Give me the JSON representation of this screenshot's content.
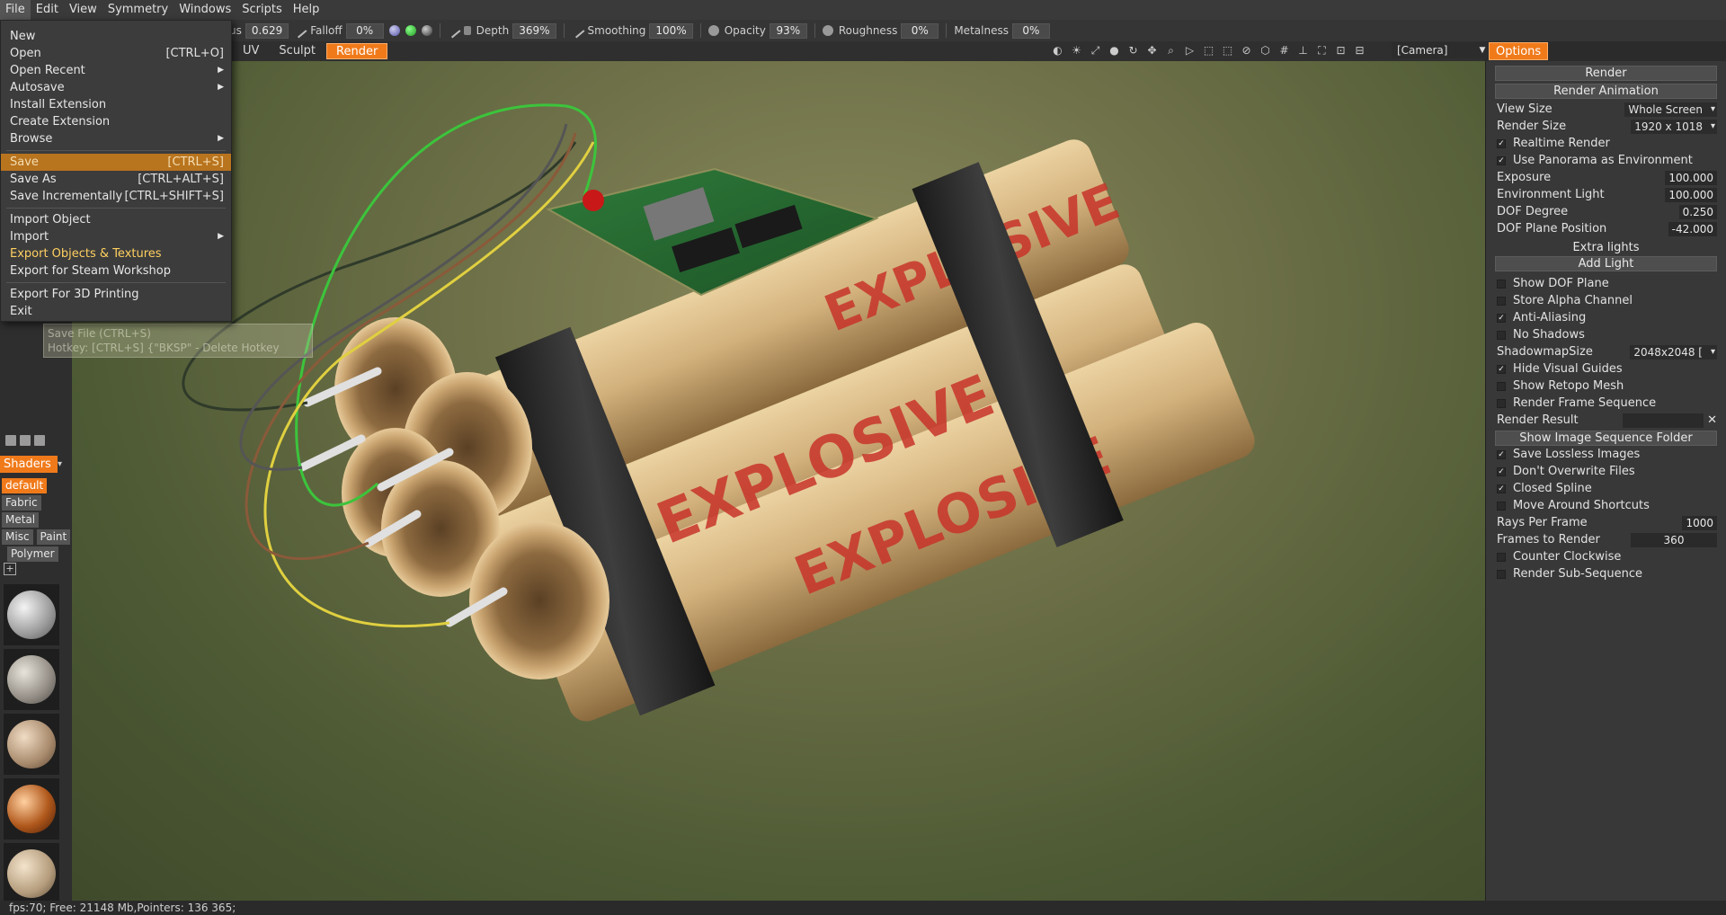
{
  "menubar": [
    "File",
    "Edit",
    "View",
    "Symmetry",
    "Windows",
    "Scripts",
    "Help"
  ],
  "toolbar": {
    "radius_label": "us",
    "radius_value": "0.629",
    "falloff_label": "Falloff",
    "falloff_value": "0%",
    "depth_label": "Depth",
    "depth_value": "369%",
    "smoothing_label": "Smoothing",
    "smoothing_value": "100%",
    "opacity_label": "Opacity",
    "opacity_value": "93%",
    "roughness_label": "Roughness",
    "roughness_value": "0%",
    "metalness_label": "Metalness",
    "metalness_value": "0%"
  },
  "rooms": {
    "uv": "UV",
    "sculpt": "Sculpt",
    "render": "Render"
  },
  "camera": "[Camera]",
  "options_tab": "Options",
  "file_menu": {
    "new": "New",
    "open": "Open",
    "open_key": "[CTRL+O]",
    "open_recent": "Open Recent",
    "autosave": "Autosave",
    "install_extension": "Install Extension",
    "create_extension": "Create Extension",
    "browse": "Browse",
    "save": "Save",
    "save_key": "[CTRL+S]",
    "save_as": "Save As",
    "save_as_key": "[CTRL+ALT+S]",
    "save_incr": "Save Incrementally",
    "save_incr_key": "[CTRL+SHIFT+S]",
    "import_object": "Import Object",
    "import": "Import",
    "export_objects": "Export Objects & Textures",
    "export_steam": "Export for Steam Workshop",
    "export_3d": "Export For 3D Printing",
    "exit": "Exit"
  },
  "tooltip": {
    "line1": "Save File (CTRL+S)",
    "line2": "Hotkey: [CTRL+S]   {\"BKSP\" - Delete  Hotkey"
  },
  "shaders": {
    "header": "Shaders",
    "tabs": [
      "default",
      "Fabric",
      "Metal",
      "Misc",
      "Paint",
      "Polymer"
    ]
  },
  "render_panel": {
    "render_btn": "Render",
    "render_anim_btn": "Render Animation",
    "view_size_label": "View Size",
    "view_size_value": "Whole Screen",
    "render_size_label": "Render Size",
    "render_size_value": "1920  x  1018",
    "realtime_render": "Realtime Render",
    "use_panorama": "Use Panorama as Environment",
    "exposure_label": "Exposure",
    "exposure_value": "100.000",
    "env_light_label": "Environment Light",
    "env_light_value": "100.000",
    "dof_degree_label": "DOF Degree",
    "dof_degree_value": "0.250",
    "dof_plane_label": "DOF Plane Position",
    "dof_plane_value": "-42.000",
    "extra_lights": "Extra lights",
    "add_light": "Add Light",
    "show_dof_plane": "Show DOF Plane",
    "store_alpha": "Store Alpha Channel",
    "anti_aliasing": "Anti-Aliasing",
    "no_shadows": "No Shadows",
    "shadowmap_label": "ShadowmapSize",
    "shadowmap_value": "2048x2048 [",
    "hide_guides": "Hide Visual Guides",
    "show_retopo": "Show Retopo Mesh",
    "render_frame_seq": "Render Frame Sequence",
    "render_result": "Render Result",
    "show_img_seq": "Show Image Sequence Folder",
    "save_lossless": "Save Lossless Images",
    "dont_overwrite": "Don't Overwrite Files",
    "closed_spline": "Closed Spline",
    "move_around": "Move Around Shortcuts",
    "rays_label": "Rays Per Frame",
    "rays_value": "1000",
    "frames_label": "Frames to Render",
    "frames_value": "360",
    "counter_clockwise": "Counter Clockwise",
    "render_subseq": "Render Sub-Sequence"
  },
  "viewport_text": {
    "label": "EXPLOSIVE"
  },
  "status": "fps:70;     Free: 21148  Mb,Pointers:  136  365;",
  "colors": {
    "accent": "#f07a1a",
    "menu_highlight": "#b9741e",
    "label_red": "#c8342a"
  }
}
